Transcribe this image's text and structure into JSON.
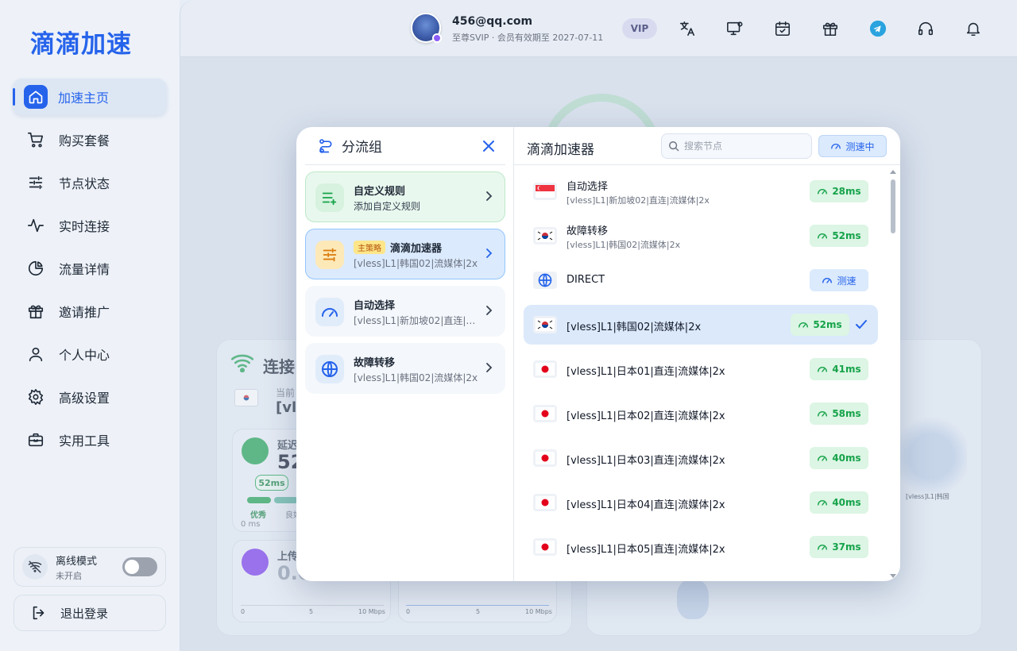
{
  "brand": "滴滴加速",
  "sidebar": {
    "items": [
      {
        "label": "加速主页",
        "icon": "home-icon",
        "active": true
      },
      {
        "label": "购买套餐",
        "icon": "cart-icon"
      },
      {
        "label": "节点状态",
        "icon": "sliders-icon"
      },
      {
        "label": "实时连接",
        "icon": "activity-icon"
      },
      {
        "label": "流量详情",
        "icon": "pie-chart-icon"
      },
      {
        "label": "邀请推广",
        "icon": "gift-icon"
      },
      {
        "label": "个人中心",
        "icon": "user-icon"
      },
      {
        "label": "高级设置",
        "icon": "gear-icon"
      },
      {
        "label": "实用工具",
        "icon": "toolbox-icon"
      }
    ],
    "offline": {
      "title": "离线模式",
      "status": "未开启"
    },
    "logout": "退出登录"
  },
  "header": {
    "email": "456@qq.com",
    "subtitle": "至尊SVIP · 会员有效期至 2027-07-11",
    "vip": "VIP",
    "icons": [
      "translate-icon",
      "monitor-settings-icon",
      "calendar-check-icon",
      "gift-icon",
      "telegram-icon",
      "headset-icon",
      "bell-icon"
    ]
  },
  "background": {
    "title": "连接",
    "current_label": "当前",
    "current_node": "[vl",
    "latency_label": "延迟",
    "latency_value": "52",
    "pill": "52ms",
    "level_good": "优秀",
    "level_ok": "良好",
    "latency_min": "0 ms",
    "upload_label": "上传",
    "upload_value": "0.0",
    "axis": [
      "0",
      "5",
      "10 Mbps"
    ],
    "map_label": "[vless]L1|韩国"
  },
  "modal": {
    "left": {
      "title": "分流组",
      "groups": [
        {
          "title": "自定义规则",
          "sub": "添加自定义规则",
          "type": "custom",
          "icon": "list-plus-icon"
        },
        {
          "tag": "主策略",
          "title": "滴滴加速器",
          "sub": "[vless]L1|韩国02|流媒体|2x",
          "type": "selected",
          "icon": "sliders-icon"
        },
        {
          "title": "自动选择",
          "sub": "[vless]L1|新加坡02|直连|流媒体|2x",
          "type": "plain",
          "icon": "speedometer-icon"
        },
        {
          "title": "故障转移",
          "sub": "[vless]L1|韩国02|流媒体|2x",
          "type": "plain",
          "icon": "globe-icon"
        }
      ]
    },
    "right": {
      "title": "滴滴加速器",
      "search_placeholder": "搜索节点",
      "test_button": "测速中",
      "nodes": [
        {
          "name": "自动选择",
          "sub": "[vless]L1|新加坡02|直连|流媒体|2x",
          "flag": "sg",
          "latency": "28ms"
        },
        {
          "name": "故障转移",
          "sub": "[vless]L1|韩国02|流媒体|2x",
          "flag": "kr",
          "latency": "52ms"
        },
        {
          "name": "DIRECT",
          "sub": "",
          "flag": "globe",
          "latency": "测速",
          "test": true
        },
        {
          "name": "[vless]L1|韩国02|流媒体|2x",
          "sub": "",
          "flag": "kr",
          "latency": "52ms",
          "active": true
        },
        {
          "name": "[vless]L1|日本01|直连|流媒体|2x",
          "sub": "",
          "flag": "jp",
          "latency": "41ms"
        },
        {
          "name": "[vless]L1|日本02|直连|流媒体|2x",
          "sub": "",
          "flag": "jp",
          "latency": "58ms"
        },
        {
          "name": "[vless]L1|日本03|直连|流媒体|2x",
          "sub": "",
          "flag": "jp",
          "latency": "40ms"
        },
        {
          "name": "[vless]L1|日本04|直连|流媒体|2x",
          "sub": "",
          "flag": "jp",
          "latency": "40ms"
        },
        {
          "name": "[vless]L1|日本05|直连|流媒体|2x",
          "sub": "",
          "flag": "jp",
          "latency": "37ms"
        }
      ]
    }
  },
  "colors": {
    "accent": "#2563eb",
    "success": "#16a34a",
    "warning": "#b45309"
  }
}
